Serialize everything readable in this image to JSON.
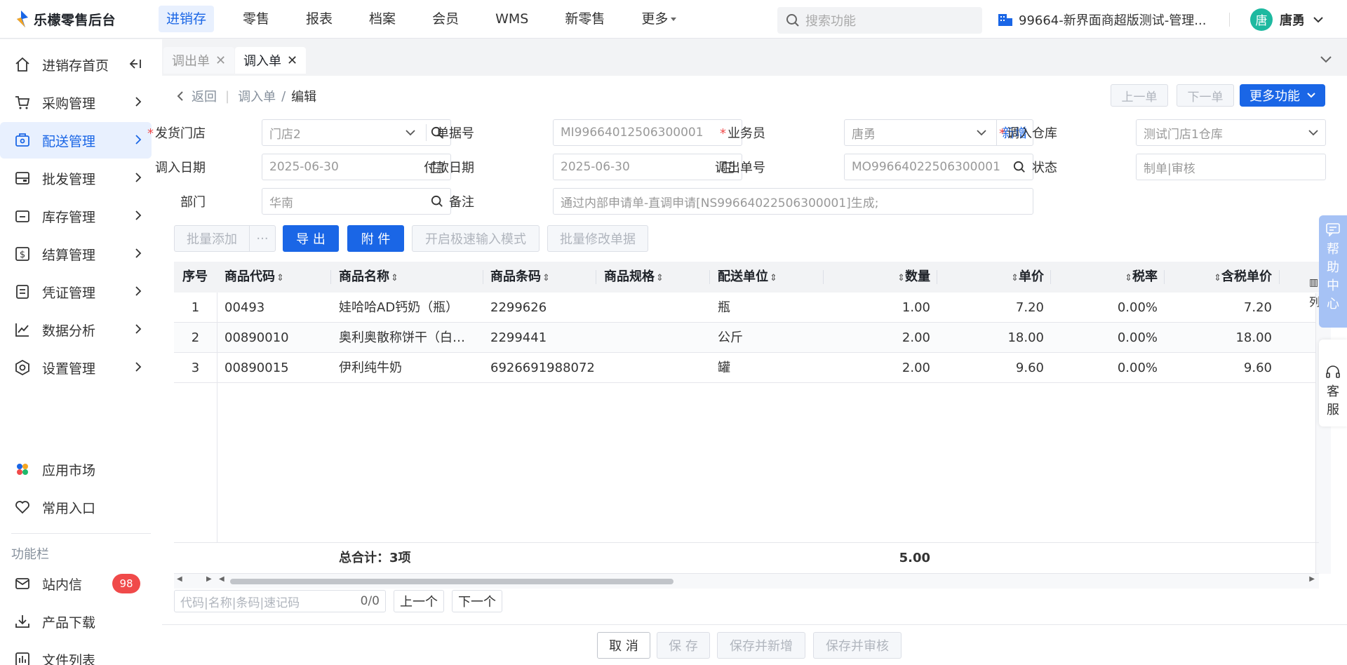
{
  "brand": "乐檬零售后台",
  "nav": [
    "进销存",
    "零售",
    "报表",
    "档案",
    "会员",
    "WMS",
    "新零售",
    "更多"
  ],
  "search_placeholder": "搜索功能",
  "store_name": "99664-新界面商超版测试-管理...",
  "user": {
    "avatar": "唐",
    "name": "唐勇"
  },
  "sidebar": {
    "items": [
      {
        "label": "进销存首页"
      },
      {
        "label": "采购管理"
      },
      {
        "label": "配送管理"
      },
      {
        "label": "批发管理"
      },
      {
        "label": "库存管理"
      },
      {
        "label": "结算管理"
      },
      {
        "label": "凭证管理"
      },
      {
        "label": "数据分析"
      },
      {
        "label": "设置管理"
      }
    ],
    "extra": [
      {
        "label": "应用市场"
      },
      {
        "label": "常用入口"
      }
    ],
    "section_title": "功能栏",
    "tools": [
      {
        "label": "站内信",
        "badge": "98"
      },
      {
        "label": "产品下载"
      },
      {
        "label": "文件列表"
      }
    ]
  },
  "tabs": [
    {
      "label": "调出单"
    },
    {
      "label": "调入单"
    }
  ],
  "breadcrumb": {
    "back": "返回",
    "parent": "调入单",
    "current": "编辑"
  },
  "nav_buttons": {
    "prev": "上一单",
    "next": "下一单",
    "more": "更多功能"
  },
  "form": {
    "ship_store": {
      "label": "发货门店",
      "value": "门店2"
    },
    "bill_no": {
      "label": "单据号",
      "value": "MI99664012506300001"
    },
    "salesman": {
      "label": "业务员",
      "value": "唐勇",
      "add": "新增"
    },
    "in_wh": {
      "label": "调入仓库",
      "value": "测试门店1仓库"
    },
    "in_date": {
      "label": "调入日期",
      "value": "2025-06-30"
    },
    "pay_date": {
      "label": "付款日期",
      "value": "2025-06-30"
    },
    "out_no": {
      "label": "调出单号",
      "value": "MO99664022506300001"
    },
    "status": {
      "label": "状态",
      "value": "制单|审核"
    },
    "dept": {
      "label": "部门",
      "value": "华南"
    },
    "remark": {
      "label": "备注",
      "value": "通过内部申请单-直调申请[NS99664022506300001]生成;"
    }
  },
  "toolbar": {
    "batch_add": "批量添加",
    "more": "···",
    "export": "导 出",
    "attach": "附 件",
    "fast_input": "开启极速输入模式",
    "batch_edit": "批量修改单据"
  },
  "table": {
    "headers": [
      "序号",
      "商品代码",
      "商品名称",
      "商品条码",
      "商品规格",
      "配送单位",
      "数量",
      "单价",
      "税率",
      "含税单价"
    ],
    "rows": [
      [
        "1",
        "00493",
        "娃哈哈AD钙奶（瓶）",
        "2299626",
        "",
        "瓶",
        "1.00",
        "7.20",
        "0.00%",
        "7.20"
      ],
      [
        "2",
        "00890010",
        "奥利奥散称饼干（白…",
        "2299441",
        "",
        "公斤",
        "2.00",
        "18.00",
        "0.00%",
        "18.00"
      ],
      [
        "3",
        "00890015",
        "伊利纯牛奶",
        "6926691988072",
        "",
        "罐",
        "2.00",
        "9.60",
        "0.00%",
        "9.60"
      ]
    ],
    "total_label": "总合计：3项",
    "total_qty": "5.00",
    "col_setting": "列"
  },
  "finder": {
    "placeholder": "代码|名称|条码|速记码",
    "count": "0/0",
    "prev": "上一个",
    "next": "下一个"
  },
  "footer": {
    "cancel": "取 消",
    "save": "保 存",
    "save_new": "保存并新增",
    "save_audit": "保存并审核"
  },
  "float": {
    "help": [
      "帮",
      "助",
      "中",
      "心"
    ],
    "service": [
      "客",
      "服"
    ]
  },
  "colors": {
    "primary": "#1a66e6",
    "badge": "#f04a4a",
    "avatar": "#1db9a0"
  }
}
